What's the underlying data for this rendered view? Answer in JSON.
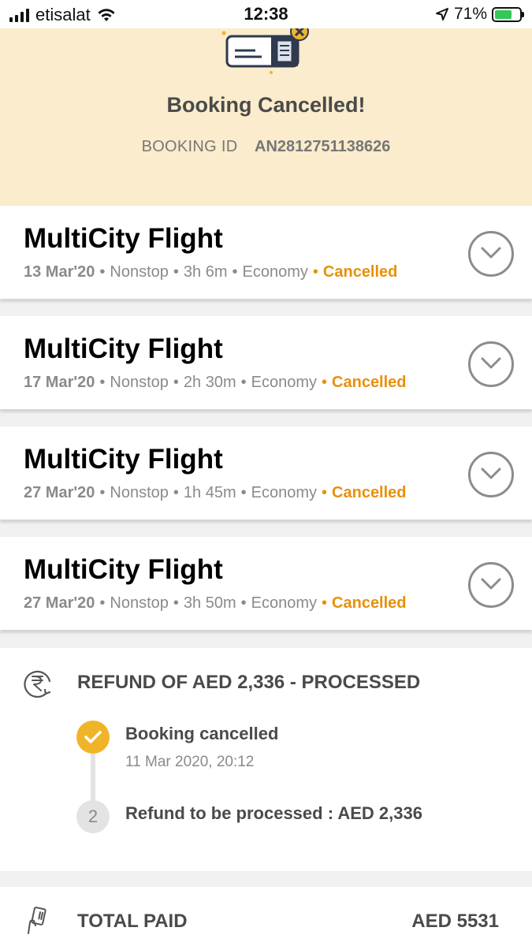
{
  "status_bar": {
    "carrier": "etisalat",
    "time": "12:38",
    "battery_percent": "71%",
    "battery_level": 0.71,
    "icons": [
      "signal-icon",
      "wifi-icon",
      "location-arrow-icon",
      "battery-charging-icon"
    ]
  },
  "header": {
    "title": "Booking Cancelled!",
    "booking_id_label": "BOOKING ID",
    "booking_id_value": "AN2812751138626",
    "icon": "cancelled-ticket-icon"
  },
  "flights": [
    {
      "title": "MultiCity Flight",
      "date": "13 Mar'20",
      "stops": "Nonstop",
      "duration": "3h 6m",
      "cabin": "Economy",
      "status": "Cancelled"
    },
    {
      "title": "MultiCity Flight",
      "date": "17 Mar'20",
      "stops": "Nonstop",
      "duration": "2h 30m",
      "cabin": "Economy",
      "status": "Cancelled"
    },
    {
      "title": "MultiCity Flight",
      "date": "27 Mar'20",
      "stops": "Nonstop",
      "duration": "1h 45m",
      "cabin": "Economy",
      "status": "Cancelled"
    },
    {
      "title": "MultiCity Flight",
      "date": "27 Mar'20",
      "stops": "Nonstop",
      "duration": "3h 50m",
      "cabin": "Economy",
      "status": "Cancelled"
    }
  ],
  "refund": {
    "title": "REFUND OF AED 2,336 - PROCESSED",
    "icon": "rupee-refund-icon",
    "steps": [
      {
        "label": "Booking cancelled",
        "time": "11 Mar 2020, 20:12",
        "state": "done"
      },
      {
        "number": "2",
        "label": "Refund to be processed : AED 2,336",
        "state": "pending"
      }
    ]
  },
  "total": {
    "label": "TOTAL PAID",
    "value": "AED 5531",
    "icon": "card-payment-icon"
  },
  "colors": {
    "header_bg": "#faeccc",
    "cancelled": "#e8900a",
    "step_done": "#f0b429",
    "battery": "#34c759"
  }
}
